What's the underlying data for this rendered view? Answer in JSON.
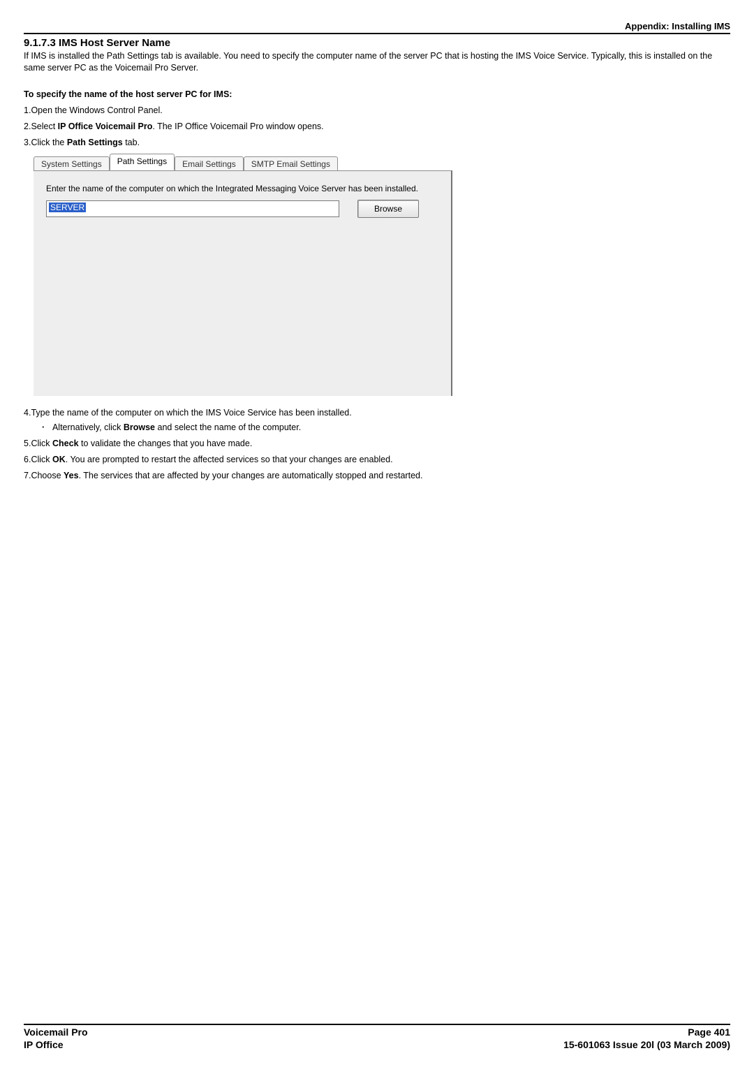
{
  "header": {
    "appendix": "Appendix: Installing IMS"
  },
  "section": {
    "number": "9.1.7.3",
    "title": "IMS Host Server Name",
    "intro": "If IMS is installed the Path Settings tab is available. You need to specify the computer name of the server PC that is hosting the IMS Voice Service. Typically, this is installed on the same server PC as the Voicemail Pro Server."
  },
  "subhead": "To specify the name of the host server PC for IMS:",
  "steps": {
    "s1": "Open the Windows Control Panel.",
    "s2a": "Select ",
    "s2b": "IP Office Voicemail Pro",
    "s2c": ". The IP Office Voicemail Pro window opens.",
    "s3a": "Click the ",
    "s3b": "Path Settings",
    "s3c": " tab.",
    "s4": "Type the name of the computer on which the IMS Voice Service has been installed.",
    "s4suba": "Alternatively, click ",
    "s4subb": "Browse",
    "s4subc": " and select the name of the computer.",
    "s5a": "Click ",
    "s5b": "Check",
    "s5c": " to validate the changes that you have made.",
    "s6a": "Click ",
    "s6b": "OK",
    "s6c": ". You are prompted to restart the affected services so that your changes are enabled.",
    "s7a": "Choose ",
    "s7b": "Yes",
    "s7c": ". The services that are affected by your changes are automatically stopped and restarted."
  },
  "panel": {
    "tabs": {
      "system": "System Settings",
      "path": "Path Settings",
      "email": "Email Settings",
      "smtp": "SMTP Email Settings"
    },
    "desc": "Enter the name of the computer on which the Integrated Messaging Voice Server has been installed.",
    "input_value": "SERVER",
    "browse": "Browse"
  },
  "footer": {
    "left1": "Voicemail Pro",
    "left2": "IP Office",
    "right1": "Page 401",
    "right2": "15-601063 Issue 20l (03 March 2009)"
  }
}
